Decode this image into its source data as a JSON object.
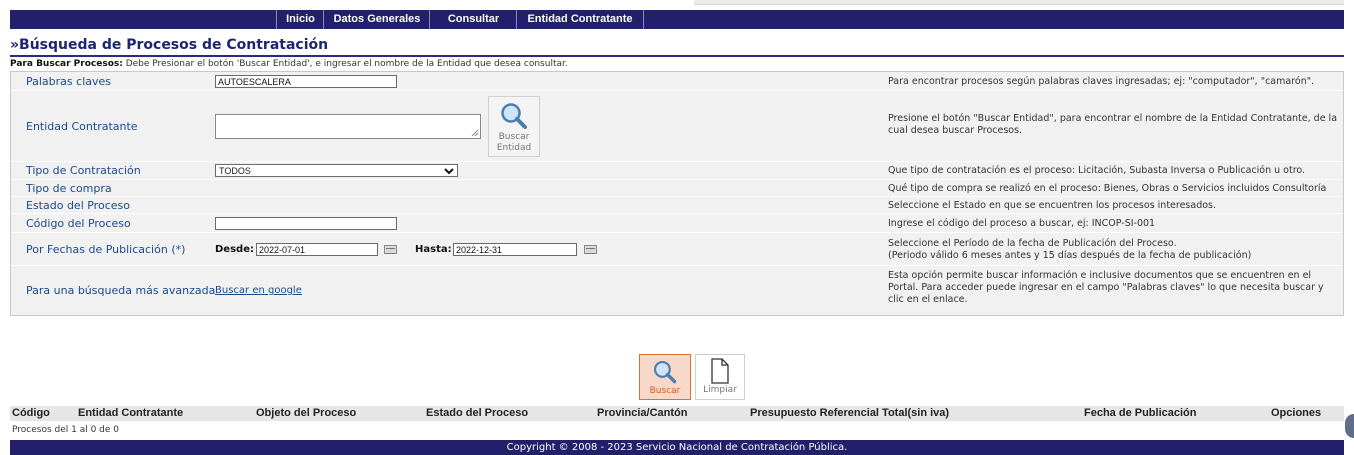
{
  "nav": {
    "items": [
      "Inicio",
      "Datos Generales",
      "Consultar",
      "Entidad Contratante"
    ]
  },
  "page": {
    "title": "»Búsqueda de Procesos de Contratación",
    "notice_bold": "Para Buscar Procesos:",
    "notice_text": " Debe Presionar el botón 'Buscar Entidad', e ingresar el nombre de la Entidad que desea consultar."
  },
  "form": {
    "palabras": {
      "label": "Palabras claves",
      "value": "AUTOESCALERA",
      "help": "Para encontrar procesos según palabras claves ingresadas; ej: \"computador\", \"camarón\"."
    },
    "entidad": {
      "label": "Entidad Contratante",
      "value": "",
      "button_label_1": "Buscar",
      "button_label_2": "Entidad",
      "help": "Presione el botón \"Buscar Entidad\", para encontrar el nombre de la Entidad Contratante, de la cual desea buscar Procesos."
    },
    "tipo_contratacion": {
      "label": "Tipo de Contratación",
      "value": "TODOS",
      "help": "Que tipo de contratación es el proceso: Licitación, Subasta Inversa o Publicación u otro."
    },
    "tipo_compra": {
      "label": "Tipo de compra",
      "help": "Qué tipo de compra se realizó en el proceso: Bienes, Obras o Servicios incluidos Consultoría"
    },
    "estado": {
      "label": "Estado del Proceso",
      "help": "Seleccione el Estado en que se encuentren los procesos interesados."
    },
    "codigo": {
      "label": "Código del Proceso",
      "value": "",
      "help": "Ingrese el código del proceso a buscar, ej: INCOP-SI-001"
    },
    "fechas": {
      "label": "Por Fechas de Publicación (*)",
      "desde_label": "Desde:",
      "desde_value": "2022-07-01",
      "hasta_label": "Hasta:",
      "hasta_value": "2022-12-31",
      "help_1": "Seleccione el Período de la fecha de Publicación del Proceso.",
      "help_2": "(Periodo válido 6 meses antes y 15 días después de la fecha de publicación)"
    },
    "avanzada": {
      "label": "Para una búsqueda más avanzada",
      "link": "Buscar en google",
      "help": "Esta opción permite buscar información e inclusive documentos que se encuentren en el Portal. Para acceder puede ingresar en el campo \"Palabras claves\" lo que necesita buscar y clic en el enlace."
    }
  },
  "actions": {
    "search_label": "Buscar",
    "clear_label": "Limpiar"
  },
  "results": {
    "columns": [
      "Código",
      "Entidad Contratante",
      "Objeto del Proceso",
      "Estado del Proceso",
      "Provincia/Cantón",
      "Presupuesto Referencial Total(sin iva)",
      "Fecha de Publicación",
      "Opciones"
    ],
    "count_text": "Procesos del 1 al 0 de 0"
  },
  "footer": {
    "text": "Copyright © 2008 - 2023 Servicio Nacional de Contratación Pública."
  },
  "colors": {
    "nav_bg": "#22206a",
    "label_blue": "#1c4a8c",
    "search_btn_bg": "#f8d8c8",
    "search_btn_border": "#e07030"
  },
  "icons": {
    "search": "magnifier-icon",
    "clear": "document-icon",
    "calendar": "calendar-icon"
  }
}
